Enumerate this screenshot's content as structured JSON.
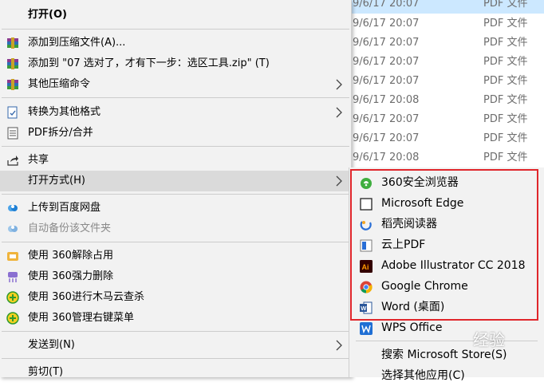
{
  "file_list": [
    {
      "date": "9/6/17 20:07",
      "type": "PDF 文件",
      "selected": true
    },
    {
      "date": "9/6/17 20:07",
      "type": "PDF 文件"
    },
    {
      "date": "9/6/17 20:07",
      "type": "PDF 文件"
    },
    {
      "date": "9/6/17 20:07",
      "type": "PDF 文件"
    },
    {
      "date": "9/6/17 20:07",
      "type": "PDF 文件"
    },
    {
      "date": "9/6/17 20:08",
      "type": "PDF 文件"
    },
    {
      "date": "9/6/17 20:07",
      "type": "PDF 文件"
    },
    {
      "date": "9/6/17 20:07",
      "type": "PDF 文件"
    },
    {
      "date": "9/6/17 20:08",
      "type": "PDF 文件"
    }
  ],
  "menu": {
    "open": "打开(O)",
    "add_archive": "添加到压缩文件(A)...",
    "add_zip": "添加到 \"07 选对了，才有下一步：选区工具.zip\" (T)",
    "other_compress": "其他压缩命令",
    "convert": "转换为其他格式",
    "pdf_split": "PDF拆分/合并",
    "share": "共享",
    "open_with": "打开方式(H)",
    "upload_baidu": "上传到百度网盘",
    "auto_backup": "自动备份该文件夹",
    "unlock_360": "使用 360解除占用",
    "force_delete_360": "使用 360强力删除",
    "trojan_scan_360": "使用 360进行木马云查杀",
    "manage_menu_360": "使用 360管理右键菜单",
    "send_to": "发送到(N)",
    "cut": "剪切(T)"
  },
  "submenu": {
    "items": [
      "360安全浏览器",
      "Microsoft Edge",
      "稻壳阅读器",
      "云上PDF",
      "Adobe Illustrator CC 2018",
      "Google Chrome",
      "Word (桌面)",
      "WPS Office"
    ],
    "search_store": "搜索 Microsoft Store(S)",
    "choose_other": "选择其他应用(C)"
  },
  "watermark": "经验"
}
